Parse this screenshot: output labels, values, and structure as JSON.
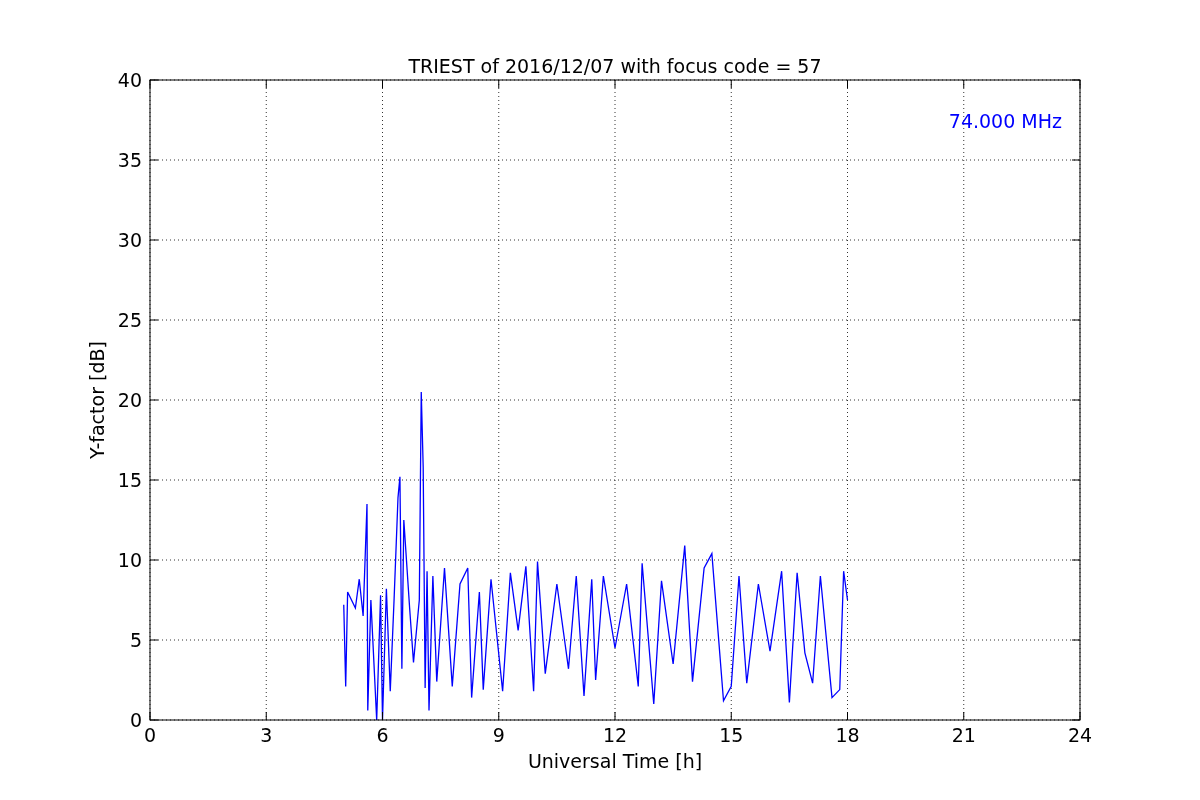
{
  "chart_data": {
    "type": "line",
    "title": "TRIEST of 2016/12/07 with focus code = 57",
    "xlabel": "Universal Time [h]",
    "ylabel": "Y-factor [dB]",
    "xlim": [
      0,
      24
    ],
    "ylim": [
      0,
      40
    ],
    "xticks": [
      0,
      3,
      6,
      9,
      12,
      15,
      18,
      21,
      24
    ],
    "yticks": [
      0,
      5,
      10,
      15,
      20,
      25,
      30,
      35,
      40
    ],
    "x": [
      5.0,
      5.05,
      5.1,
      5.3,
      5.4,
      5.5,
      5.6,
      5.62,
      5.7,
      5.85,
      5.95,
      6.0,
      6.1,
      6.2,
      6.3,
      6.4,
      6.45,
      6.5,
      6.55,
      6.7,
      6.8,
      6.95,
      7.0,
      7.05,
      7.1,
      7.15,
      7.2,
      7.3,
      7.4,
      7.6,
      7.8,
      8.0,
      8.2,
      8.3,
      8.5,
      8.6,
      8.8,
      9.1,
      9.3,
      9.5,
      9.7,
      9.9,
      10.0,
      10.2,
      10.5,
      10.8,
      11.0,
      11.2,
      11.4,
      11.5,
      11.7,
      12.0,
      12.3,
      12.6,
      12.7,
      13.0,
      13.2,
      13.5,
      13.8,
      14.0,
      14.3,
      14.5,
      14.8,
      15.0,
      15.2,
      15.4,
      15.7,
      16.0,
      16.3,
      16.5,
      16.7,
      16.9,
      17.1,
      17.3,
      17.6,
      17.8,
      17.9,
      18.0
    ],
    "series": [
      {
        "name": "74.000 MHz",
        "color": "#0000ff",
        "values": [
          7.2,
          2.1,
          8.0,
          7.0,
          8.8,
          6.5,
          13.5,
          0.6,
          7.5,
          0.0,
          7.8,
          0.0,
          8.2,
          1.8,
          7.6,
          13.9,
          15.2,
          3.2,
          12.5,
          7.0,
          3.6,
          7.5,
          20.5,
          15.8,
          2.0,
          9.3,
          0.6,
          9.0,
          2.4,
          9.5,
          2.1,
          8.5,
          9.5,
          1.4,
          8.0,
          1.9,
          8.8,
          1.8,
          9.2,
          5.6,
          9.6,
          1.8,
          9.9,
          2.9,
          8.5,
          3.2,
          9.0,
          1.5,
          8.8,
          2.5,
          9.0,
          4.5,
          8.5,
          2.1,
          9.8,
          1.0,
          8.7,
          3.5,
          10.9,
          2.4,
          9.5,
          10.4,
          1.2,
          2.1,
          9.0,
          2.3,
          8.5,
          4.3,
          9.3,
          1.1,
          9.2,
          4.2,
          2.3,
          9.0,
          1.4,
          1.9,
          9.3,
          7.5
        ]
      }
    ],
    "grid": true
  }
}
